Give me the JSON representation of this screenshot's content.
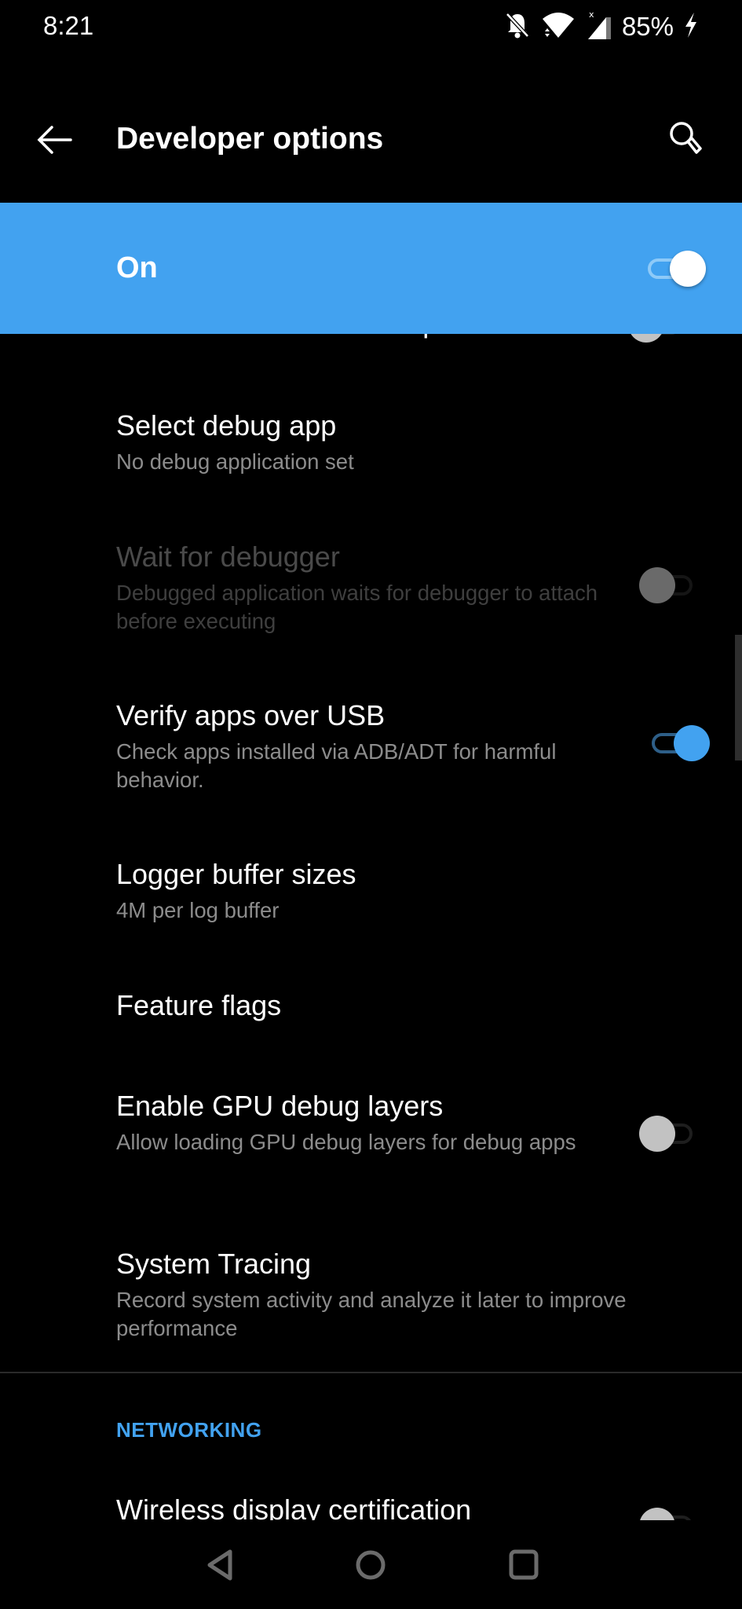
{
  "status_bar": {
    "time": "8:21",
    "icons": [
      "notifications-off-icon",
      "wifi-icon",
      "cell-signal-icon",
      "charging-icon"
    ],
    "battery": "85%"
  },
  "app_bar": {
    "title": "Developer options",
    "back_icon": "arrow-back-icon",
    "search_icon": "search-icon"
  },
  "master_switch": {
    "label": "On",
    "checked": true,
    "color": "#42a2f0"
  },
  "items": [
    {
      "title": "Enable view attribute inspection",
      "switch": "off",
      "clipped": true
    },
    {
      "title": "Select debug app",
      "subtitle": "No debug application set"
    },
    {
      "title": "Wait for debugger",
      "subtitle": "Debugged application waits for debugger to attach before executing",
      "switch": "off",
      "disabled": true
    },
    {
      "title": "Verify apps over USB",
      "subtitle": "Check apps installed via ADB/ADT for harmful behavior.",
      "switch": "on"
    },
    {
      "title": "Logger buffer sizes",
      "subtitle": "4M per log buffer"
    },
    {
      "title": "Feature flags"
    },
    {
      "title": "Enable GPU debug layers",
      "subtitle": "Allow loading GPU debug layers for debug apps",
      "switch": "off"
    },
    {
      "title": "System Tracing",
      "subtitle": "Record system activity and analyze it later to improve performance"
    }
  ],
  "sections": [
    {
      "header": "NETWORKING",
      "items": [
        {
          "title": "Wireless display certification",
          "switch": "off",
          "clipped": true
        }
      ]
    }
  ],
  "nav_bar": {
    "back": "nav-back-icon",
    "home": "nav-home-icon",
    "recents": "nav-recents-icon"
  },
  "colors": {
    "accent": "#42a2f0",
    "background": "#000000",
    "subtitle": "#8c8c8c"
  }
}
